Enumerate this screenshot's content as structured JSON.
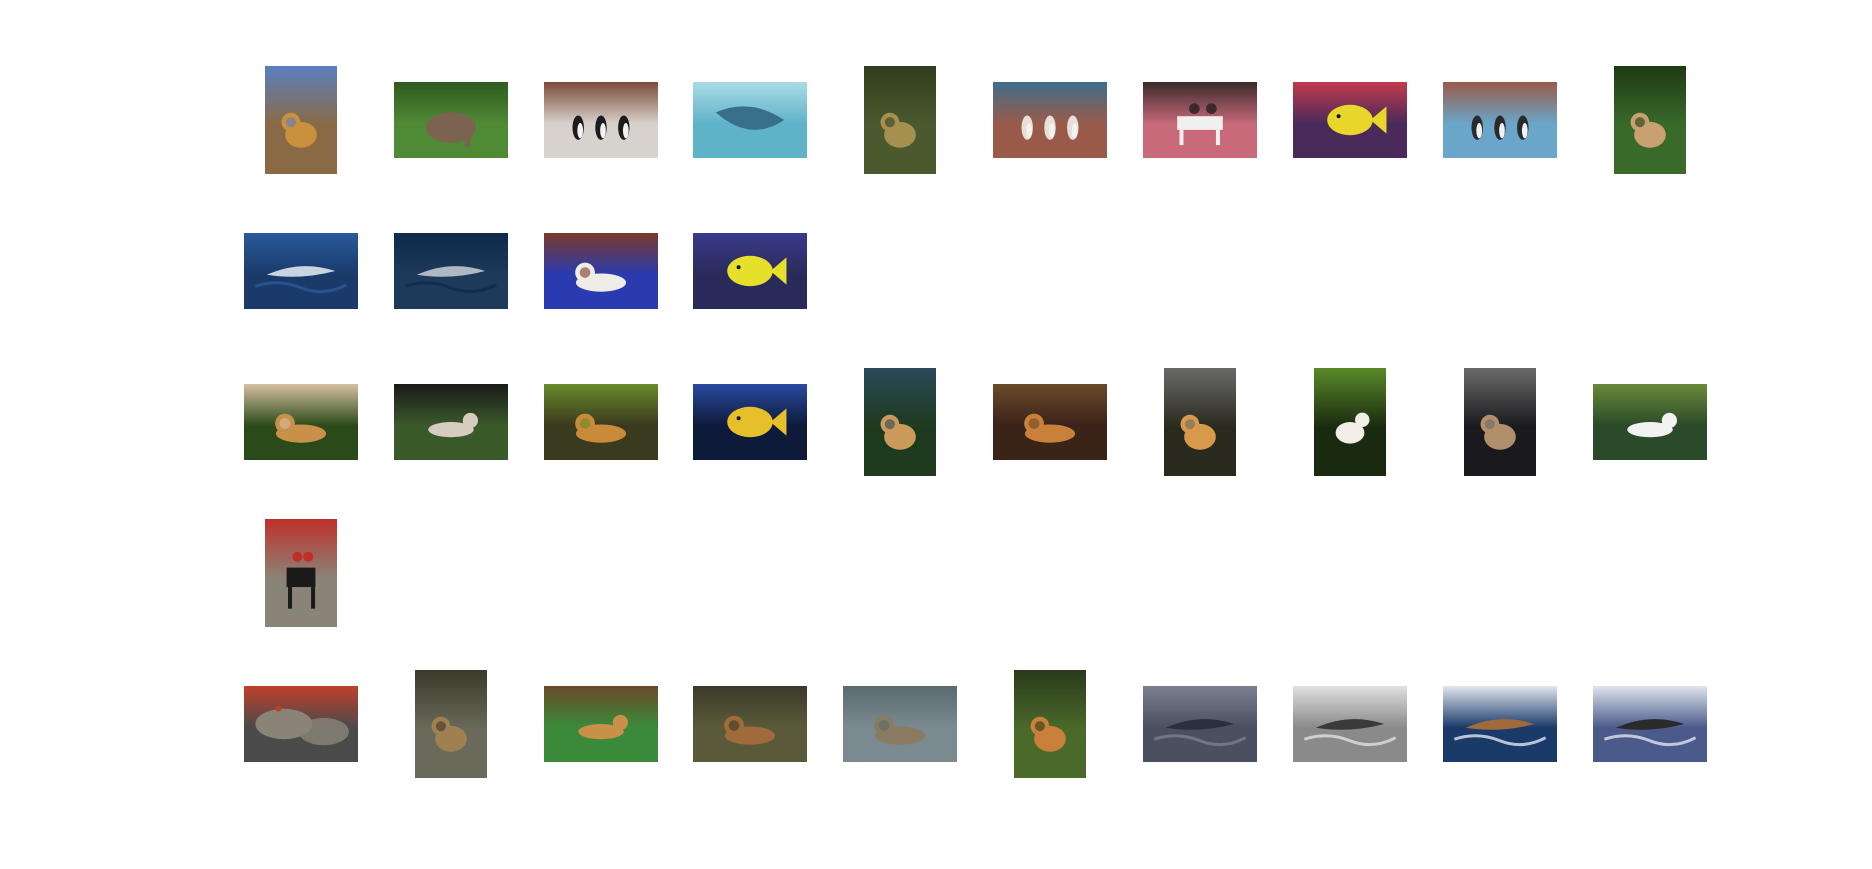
{
  "rows": [
    {
      "name": "row-1",
      "items": [
        {
          "name": "lion-photo",
          "orient": "portrait",
          "bg": "#8a6a44",
          "fg": "#c9903e",
          "accent": "#5a7fbf",
          "subject": "lion"
        },
        {
          "name": "elephant-photo",
          "orient": "landscape",
          "bg": "#4f8a35",
          "fg": "#7a6450",
          "accent": "#2f5a1e",
          "subject": "elephant"
        },
        {
          "name": "penguins-photo",
          "orient": "landscape",
          "bg": "#d8d2cc",
          "fg": "#1c1c1c",
          "accent": "#7a4a3a",
          "subject": "penguin"
        },
        {
          "name": "stingray-photo",
          "orient": "landscape",
          "bg": "#5fb3c9",
          "fg": "#3a6f8a",
          "accent": "#a9dbe6",
          "subject": "ray"
        },
        {
          "name": "lion-field-photo",
          "orient": "portrait",
          "bg": "#4a5a2e",
          "fg": "#a59050",
          "accent": "#2e3e1e",
          "subject": "lion"
        },
        {
          "name": "penguins-rocks-photo",
          "orient": "landscape",
          "bg": "#9a5a4a",
          "fg": "#e6e0d6",
          "accent": "#3f6e8a",
          "subject": "penguin"
        },
        {
          "name": "horse-crowd-photo",
          "orient": "landscape",
          "bg": "#c86a7a",
          "fg": "#f0f0f0",
          "accent": "#3a2a2a",
          "subject": "horse"
        },
        {
          "name": "yellow-fish-photo",
          "orient": "landscape",
          "bg": "#4a2a5a",
          "fg": "#e8d62a",
          "accent": "#c23a4a",
          "subject": "fish"
        },
        {
          "name": "penguins-beach-photo",
          "orient": "landscape",
          "bg": "#6aa6c9",
          "fg": "#2a2a2a",
          "accent": "#9a5a4a",
          "subject": "penguin"
        },
        {
          "name": "leopard-jungle-photo",
          "orient": "portrait",
          "bg": "#3a6a2a",
          "fg": "#c9a070",
          "accent": "#1e3a14",
          "subject": "cat"
        }
      ]
    },
    {
      "name": "row-2",
      "items": [
        {
          "name": "dolphin-photo",
          "orient": "landscape",
          "bg": "#1a3a6a",
          "fg": "#c9d4e0",
          "accent": "#2a5a9a",
          "subject": "dolphin"
        },
        {
          "name": "dolphin-swim-photo",
          "orient": "landscape",
          "bg": "#1e3a5a",
          "fg": "#b0b8c4",
          "accent": "#0e2a4a",
          "subject": "dolphin"
        },
        {
          "name": "persian-cat-photo",
          "orient": "landscape",
          "bg": "#2a3ab0",
          "fg": "#f0ece6",
          "accent": "#7a3a2a",
          "subject": "cat"
        },
        {
          "name": "butterflyfish-photo",
          "orient": "landscape",
          "bg": "#2a2a5a",
          "fg": "#e6e02a",
          "accent": "#3a3a8a",
          "subject": "fish"
        }
      ]
    },
    {
      "name": "row-3",
      "items": [
        {
          "name": "tiger-forest-photo",
          "orient": "landscape",
          "bg": "#2a4a1a",
          "fg": "#c9904a",
          "accent": "#d6c0a0",
          "subject": "tiger"
        },
        {
          "name": "dog-grass-photo",
          "orient": "landscape",
          "bg": "#3a5a2a",
          "fg": "#d6ccc0",
          "accent": "#1a1a1a",
          "subject": "dog"
        },
        {
          "name": "tiger-rest-photo",
          "orient": "landscape",
          "bg": "#3a3a1e",
          "fg": "#c98a3a",
          "accent": "#6a8a2a",
          "subject": "tiger"
        },
        {
          "name": "angelfish-photo",
          "orient": "landscape",
          "bg": "#0e1a3a",
          "fg": "#e6c02a",
          "accent": "#2a4aa0",
          "subject": "fish"
        },
        {
          "name": "tiger-water-photo",
          "orient": "portrait",
          "bg": "#1e3a1e",
          "fg": "#c99a5a",
          "accent": "#2a4a5a",
          "subject": "tiger"
        },
        {
          "name": "tiger-rocks-photo",
          "orient": "landscape",
          "bg": "#3a2418",
          "fg": "#c9803a",
          "accent": "#6a4a2a",
          "subject": "tiger"
        },
        {
          "name": "tiger-stream-photo",
          "orient": "portrait",
          "bg": "#2a2a1e",
          "fg": "#d69a4a",
          "accent": "#6a6a6a",
          "subject": "tiger"
        },
        {
          "name": "white-dogs-photo",
          "orient": "portrait",
          "bg": "#1a2a10",
          "fg": "#f0eee6",
          "accent": "#5a8a2a",
          "subject": "dog"
        },
        {
          "name": "lynx-photo",
          "orient": "portrait",
          "bg": "#1a1a1e",
          "fg": "#b0906a",
          "accent": "#6a6a6a",
          "subject": "cat"
        },
        {
          "name": "white-dog-photo",
          "orient": "landscape",
          "bg": "#2a4a2a",
          "fg": "#f2f2f2",
          "accent": "#6a8a3a",
          "subject": "dog"
        }
      ]
    },
    {
      "name": "row-4",
      "items": [
        {
          "name": "horse-guards-photo",
          "orient": "portrait",
          "bg": "#8a8478",
          "fg": "#1a1a1a",
          "accent": "#c0302a",
          "subject": "horse"
        }
      ]
    },
    {
      "name": "row-5",
      "items": [
        {
          "name": "rock-birds-photo",
          "orient": "landscape",
          "bg": "#4a4a4a",
          "fg": "#8a8478",
          "accent": "#c0402a",
          "subject": "rock"
        },
        {
          "name": "lion-lying-photo",
          "orient": "portrait",
          "bg": "#6a6a5a",
          "fg": "#a08050",
          "accent": "#3a3a2a",
          "subject": "lion"
        },
        {
          "name": "golden-retriever-photo",
          "orient": "landscape",
          "bg": "#3a8a3a",
          "fg": "#c9904a",
          "accent": "#6a4a2a",
          "subject": "dog"
        },
        {
          "name": "cubs-field-photo",
          "orient": "landscape",
          "bg": "#5a5a3a",
          "fg": "#a06a3a",
          "accent": "#3a3a2a",
          "subject": "lion"
        },
        {
          "name": "lynx-pair-photo",
          "orient": "landscape",
          "bg": "#7a8a90",
          "fg": "#8a7a60",
          "accent": "#5a6a70",
          "subject": "cat"
        },
        {
          "name": "lion-grass-photo",
          "orient": "portrait",
          "bg": "#4a6a2a",
          "fg": "#c9803a",
          "accent": "#2a3a1a",
          "subject": "lion"
        },
        {
          "name": "dolphins-grey-photo",
          "orient": "landscape",
          "bg": "#4a5060",
          "fg": "#2a3040",
          "accent": "#7a8090",
          "subject": "dolphin"
        },
        {
          "name": "dolphins-jump-photo",
          "orient": "landscape",
          "bg": "#8a8a8a",
          "fg": "#3a3a3a",
          "accent": "#e0e0e0",
          "subject": "dolphin"
        },
        {
          "name": "whale-tail-photo",
          "orient": "landscape",
          "bg": "#1a3a6a",
          "fg": "#a06a3a",
          "accent": "#e0e6ee",
          "subject": "whale"
        },
        {
          "name": "whale-fin-photo",
          "orient": "landscape",
          "bg": "#4a5a8a",
          "fg": "#2a2a2a",
          "accent": "#e0e4ee",
          "subject": "whale"
        }
      ]
    }
  ]
}
